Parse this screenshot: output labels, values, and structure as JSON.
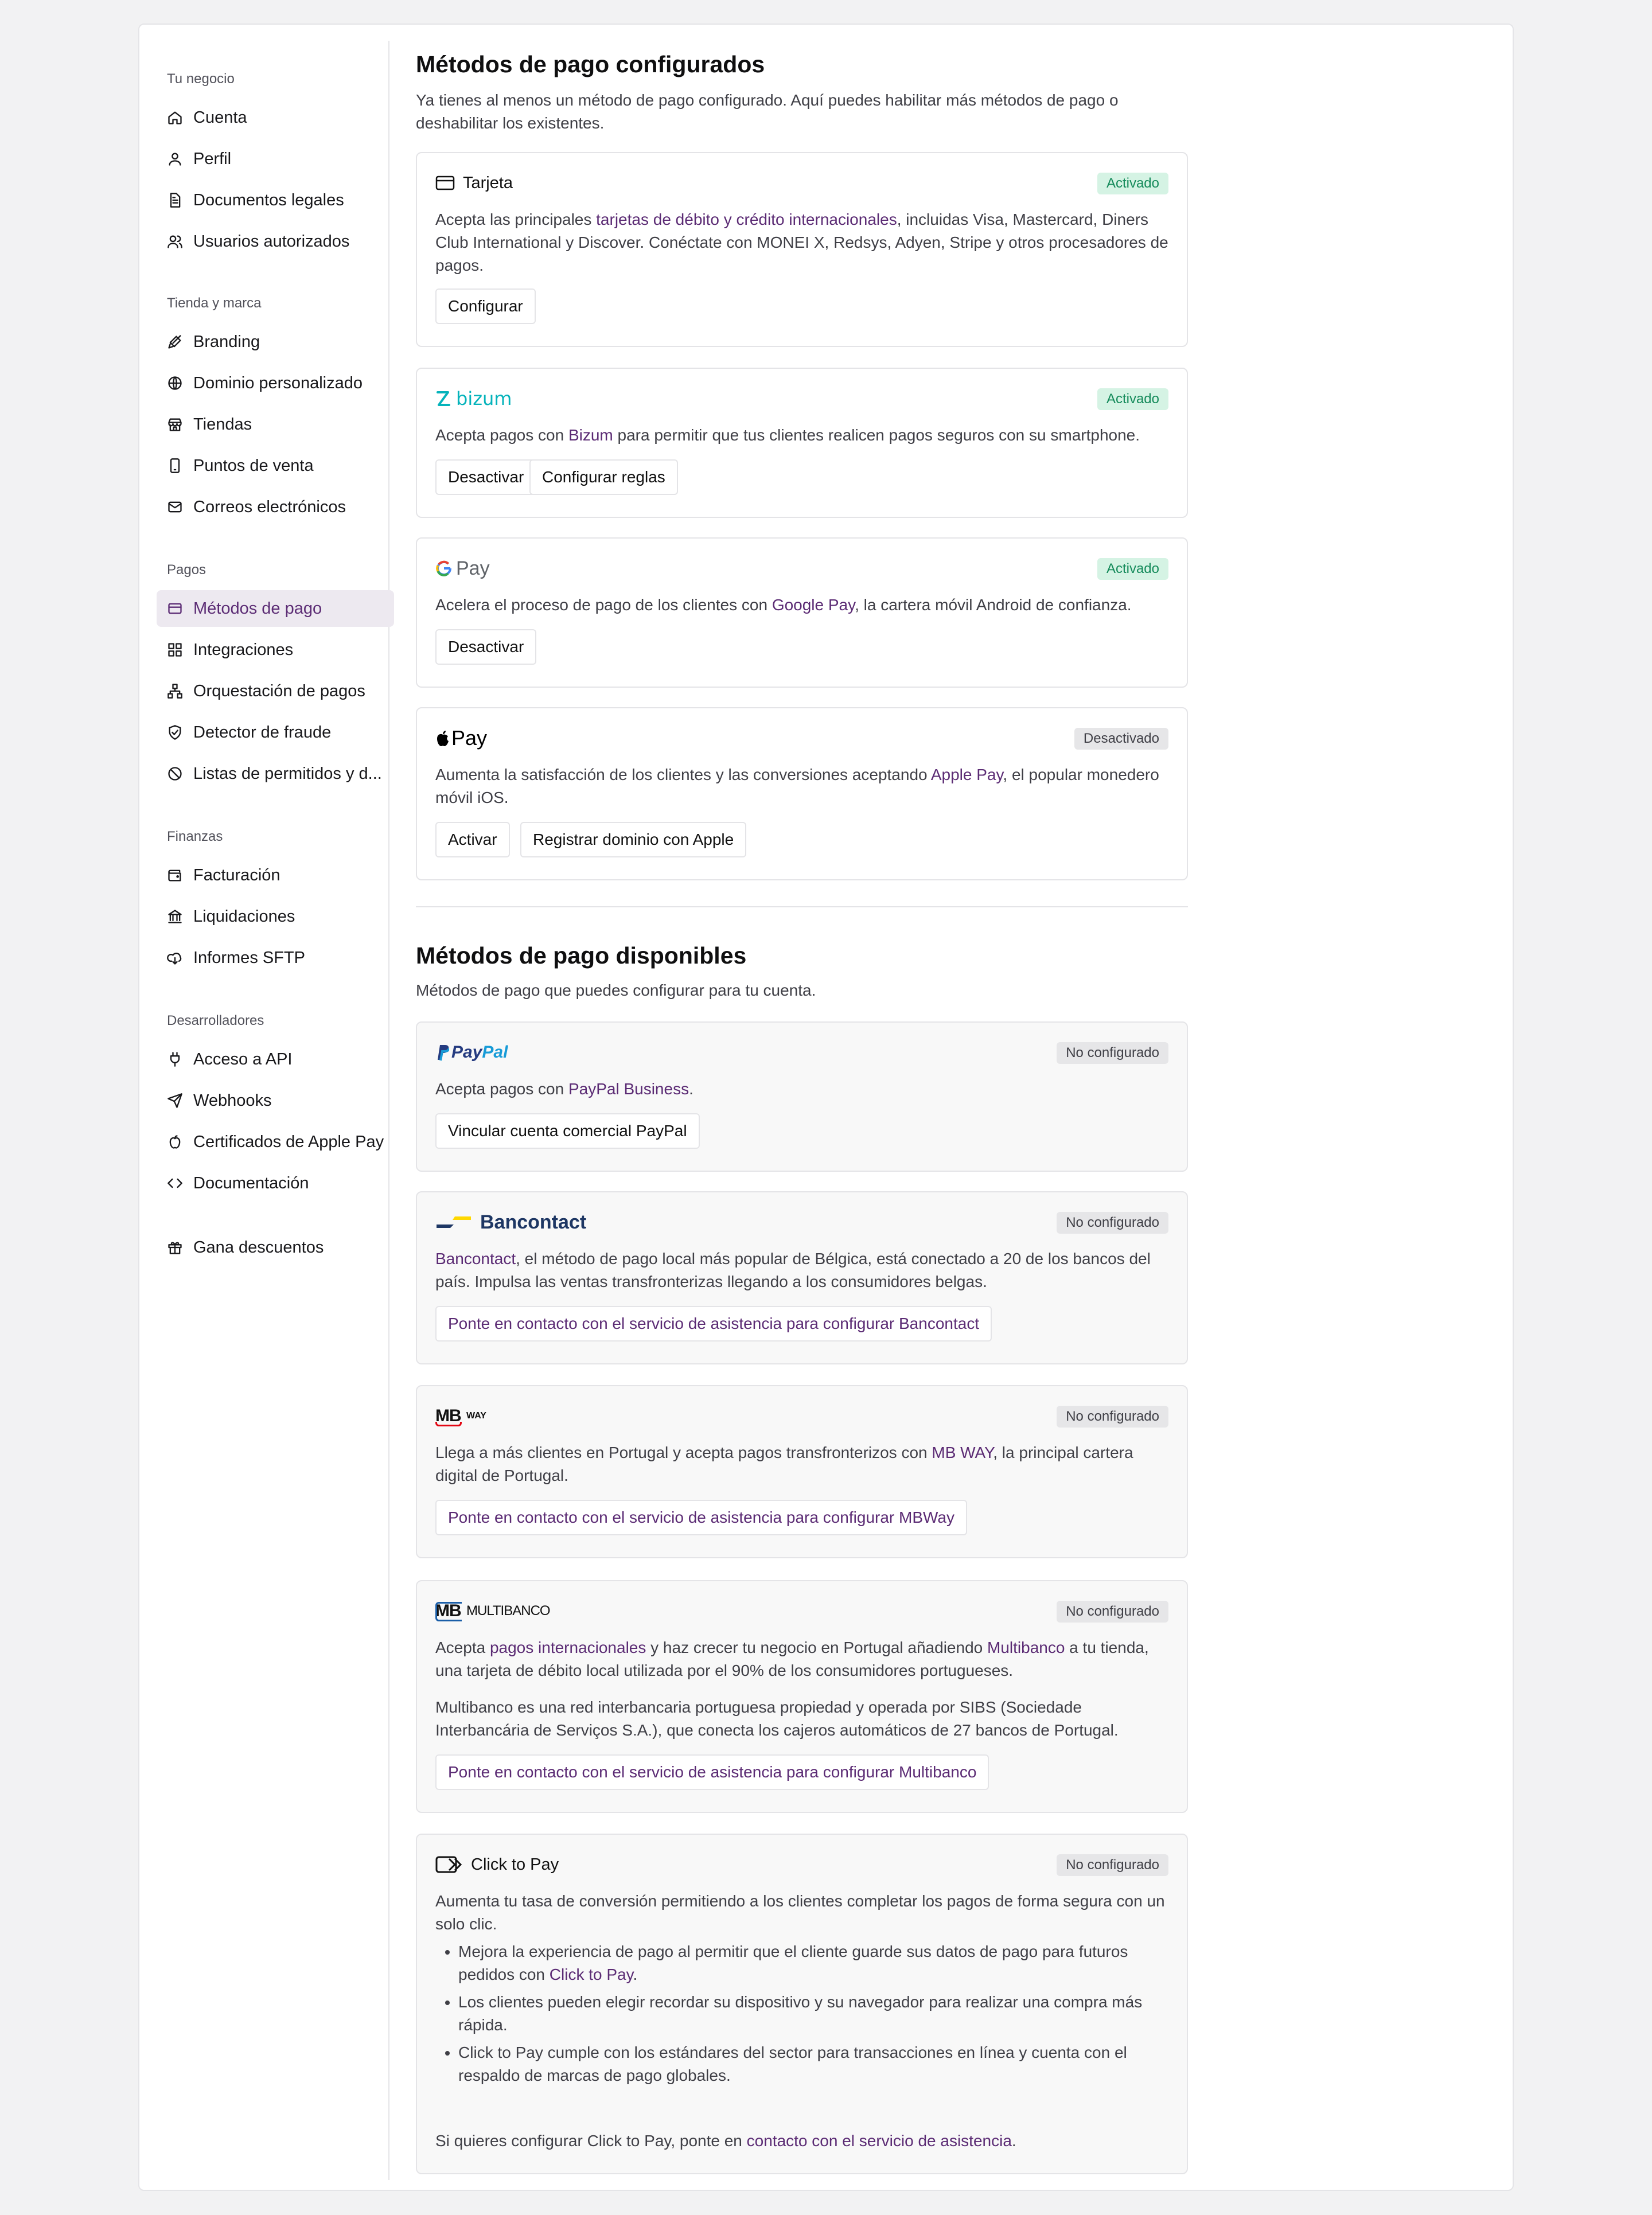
{
  "colors": {
    "accent": "#5b2b74",
    "active_bg": "#ede9f0",
    "enabled_green": "#148a5a",
    "bizum": "#05b3bb",
    "paypal_dark": "#253b80",
    "paypal_light": "#179bd7",
    "bancontact_blue": "#1e3764",
    "bancontact_yellow": "#ffd800"
  },
  "sidebar": {
    "groups": [
      {
        "title": "Tu negocio",
        "items": [
          {
            "label": "Cuenta",
            "icon": "home-icon"
          },
          {
            "label": "Perfil",
            "icon": "user-icon"
          },
          {
            "label": "Documentos legales",
            "icon": "document-icon"
          },
          {
            "label": "Usuarios autorizados",
            "icon": "users-icon"
          }
        ]
      },
      {
        "title": "Tienda y marca",
        "items": [
          {
            "label": "Branding",
            "icon": "brush-icon"
          },
          {
            "label": "Dominio personalizado",
            "icon": "globe-icon"
          },
          {
            "label": "Tiendas",
            "icon": "store-icon"
          },
          {
            "label": "Puntos de venta",
            "icon": "tablet-icon"
          },
          {
            "label": "Correos electrónicos",
            "icon": "mail-icon"
          }
        ]
      },
      {
        "title": "Pagos",
        "items": [
          {
            "label": "Métodos de pago",
            "icon": "credit-card-icon",
            "active": true
          },
          {
            "label": "Integraciones",
            "icon": "grid-icon"
          },
          {
            "label": "Orquestación de pagos",
            "icon": "network-icon"
          },
          {
            "label": "Detector de fraude",
            "icon": "shield-check-icon"
          },
          {
            "label": "Listas de permitidos y d...",
            "icon": "ban-icon"
          }
        ]
      },
      {
        "title": "Finanzas",
        "items": [
          {
            "label": "Facturación",
            "icon": "wallet-icon"
          },
          {
            "label": "Liquidaciones",
            "icon": "bank-icon"
          },
          {
            "label": "Informes SFTP",
            "icon": "cloud-download-icon"
          }
        ]
      },
      {
        "title": "Desarrolladores",
        "items": [
          {
            "label": "Acceso a API",
            "icon": "plug-icon"
          },
          {
            "label": "Webhooks",
            "icon": "send-icon"
          },
          {
            "label": "Certificados de Apple Pay",
            "icon": "apple-icon"
          },
          {
            "label": "Documentación",
            "icon": "code-icon"
          }
        ]
      },
      {
        "title": "",
        "items": [
          {
            "label": "Gana descuentos",
            "icon": "gift-icon"
          }
        ]
      }
    ]
  },
  "configured": {
    "title": "Métodos de pago configurados",
    "subtitle": "Ya tienes al menos un método de pago configurado. Aquí puedes habilitar más métodos de pago o deshabilitar los existentes.",
    "card": {
      "name": "Tarjeta",
      "status": "Activado",
      "desc_pre": "Acepta las principales ",
      "desc_link": "tarjetas de débito y crédito internacionales",
      "desc_post": ", incluidas Visa, Mastercard, Diners Club International y Discover. Conéctate con MONEI X, Redsys, Adyen, Stripe y otros procesadores de pagos.",
      "btn_configure": "Configurar"
    },
    "bizum": {
      "name": "bizum",
      "status": "Activado",
      "desc_pre": "Acepta pagos con ",
      "desc_link": "Bizum",
      "desc_post": " para permitir que tus clientes realicen pagos seguros con su smartphone.",
      "btn_disable": "Desactivar",
      "btn_rules": "Configurar reglas"
    },
    "gpay": {
      "name": "Pay",
      "status": "Activado",
      "desc_pre": "Acelera el proceso de pago de los clientes con ",
      "desc_link": "Google Pay",
      "desc_post": ", la cartera móvil Android de confianza.",
      "btn_disable": "Desactivar"
    },
    "applepay": {
      "name": "Pay",
      "status": "Desactivado",
      "desc_pre": "Aumenta la satisfacción de los clientes y las conversiones aceptando ",
      "desc_link": "Apple Pay",
      "desc_post": ", el popular monedero móvil iOS.",
      "btn_enable": "Activar",
      "btn_register": "Registrar dominio con Apple"
    }
  },
  "available": {
    "title": "Métodos de pago disponibles",
    "subtitle": "Métodos de pago que puedes configurar para tu cuenta.",
    "paypal": {
      "name_a": "Pay",
      "name_b": "Pal",
      "status": "No configurado",
      "desc_pre": "Acepta pagos con ",
      "desc_link": "PayPal Business",
      "desc_post": ".",
      "btn": "Vincular cuenta comercial PayPal"
    },
    "bancontact": {
      "name": "Bancontact",
      "status": "No configurado",
      "desc_link": "Bancontact",
      "desc_post": ", el método de pago local más popular de Bélgica, está conectado a 20 de los bancos del país. Impulsa las ventas transfronterizas llegando a los consumidores belgas.",
      "btn": "Ponte en contacto con el servicio de asistencia para configurar Bancontact"
    },
    "mbway": {
      "name_a": "MB",
      "name_b": "WAY",
      "status": "No configurado",
      "desc_pre": "Llega a más clientes en Portugal y acepta pagos transfronterizos con ",
      "desc_link": "MB WAY",
      "desc_post": ", la principal cartera digital de Portugal.",
      "btn": "Ponte en contacto con el servicio de asistencia para configurar MBWay"
    },
    "multibanco": {
      "name_a": "MB",
      "name_b": "MULTIBANCO",
      "status": "No configurado",
      "desc1_pre": "Acepta ",
      "desc1_link1": "pagos internacionales",
      "desc1_mid": " y haz crecer tu negocio en Portugal añadiendo ",
      "desc1_link2": "Multibanco",
      "desc1_post": " a tu tienda, una tarjeta de débito local utilizada por el 90% de los consumidores portugueses.",
      "desc2": "Multibanco es una red interbancaria portuguesa propiedad y operada por SIBS (Sociedade Interbancária de Serviços S.A.), que conecta los cajeros automáticos de 27 bancos de Portugal.",
      "btn": "Ponte en contacto con el servicio de asistencia para configurar Multibanco"
    },
    "clicktopay": {
      "name": "Click to Pay",
      "status": "No configurado",
      "desc": "Aumenta tu tasa de conversión permitiendo a los clientes completar los pagos de forma segura con un solo clic.",
      "bullet1_pre": "Mejora la experiencia de pago al permitir que el cliente guarde sus datos de pago para futuros pedidos con ",
      "bullet1_link": "Click to Pay",
      "bullet1_post": ".",
      "bullet2": "Los clientes pueden elegir recordar su dispositivo y su navegador para realizar una compra más rápida.",
      "bullet3": "Click to Pay cumple con los estándares del sector para transacciones en línea y cuenta con el respaldo de marcas de pago globales.",
      "footer_pre": "Si quieres configurar Click to Pay, ponte en ",
      "footer_link": "contacto con el servicio de asistencia",
      "footer_post": "."
    }
  }
}
